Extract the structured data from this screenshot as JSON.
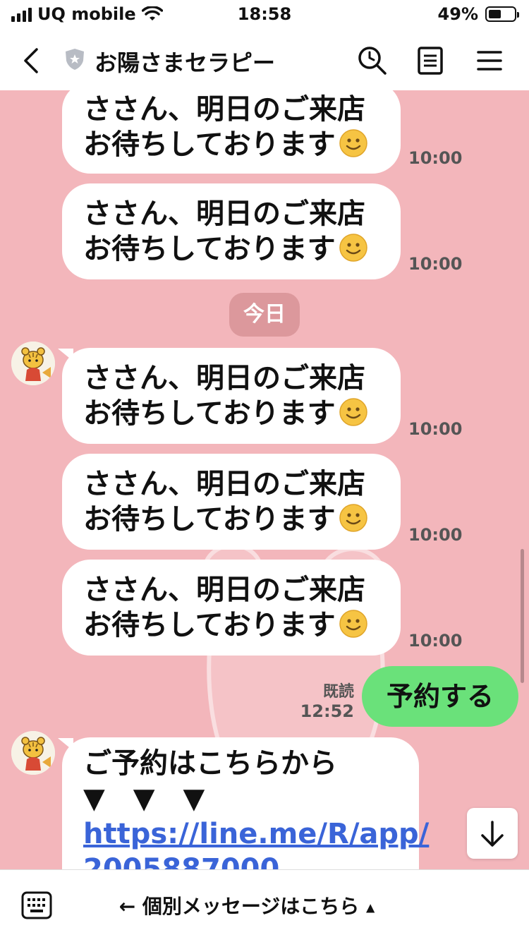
{
  "status_bar": {
    "carrier": "UQ mobile",
    "time": "18:58",
    "battery_percent": "49%",
    "battery_level": 0.49
  },
  "header": {
    "title": "お陽さまセラピー",
    "icons": [
      "back-icon",
      "shield-star-icon",
      "search-icon",
      "notes-icon",
      "menu-icon"
    ]
  },
  "messages": {
    "m1": {
      "line1": "ささん、明日のご来店",
      "line2": "お待ちしております",
      "time": "10:00"
    },
    "m2": {
      "line1": "ささん、明日のご来店",
      "line2": "お待ちしております",
      "time": "10:00"
    },
    "date_divider": "今日",
    "m3": {
      "line1": "ささん、明日のご来店",
      "line2": "お待ちしております",
      "time": "10:00"
    },
    "m4": {
      "line1": "ささん、明日のご来店",
      "line2": "お待ちしております",
      "time": "10:00"
    },
    "m5": {
      "line1": "ささん、明日のご来店",
      "line2": "お待ちしております",
      "time": "10:00"
    },
    "mine": {
      "text": "予約する",
      "read": "既読",
      "time": "12:52"
    },
    "m6": {
      "line1": "ご予約はこちらから",
      "line2": "▼　▼　▼",
      "link": "https://line.me/R/app/",
      "link_cut": "2005887000"
    }
  },
  "bottom_bar": {
    "menu_label": "← 個別メッセージはこちら",
    "caret": "▲"
  },
  "colors": {
    "chat_bg": "#f3b6bb",
    "my_bubble": "#6ae17a",
    "link": "#3a64d8"
  }
}
